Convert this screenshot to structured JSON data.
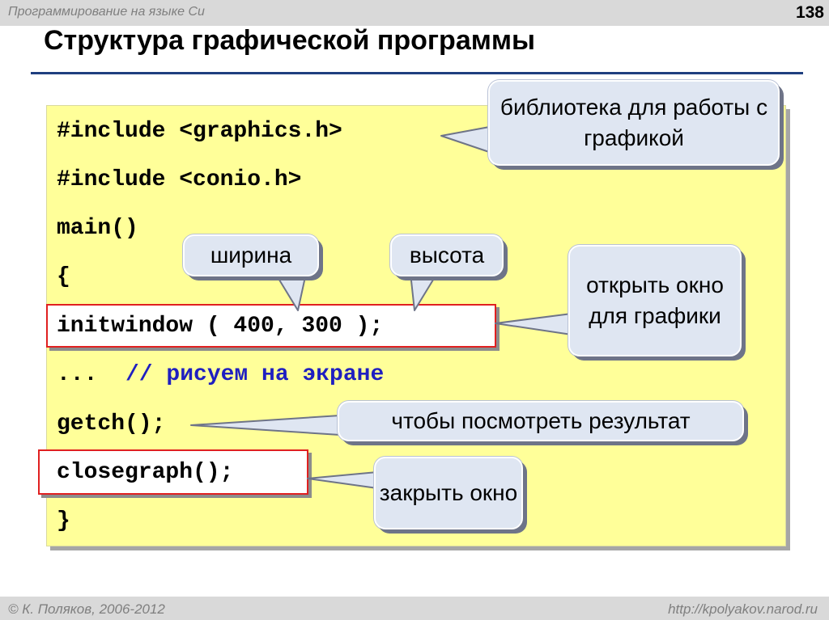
{
  "header": {
    "course": "Программирование на языке Си",
    "page_number": "138"
  },
  "slide": {
    "title": "Структура графической программы"
  },
  "code": {
    "lines": [
      "#include <graphics.h>",
      "#include <conio.h>",
      "main()",
      "{",
      "initwindow ( 400, 300 );",
      "... ",
      "// рисуем на экране",
      "getch();",
      "closegraph();",
      "}"
    ]
  },
  "callouts": {
    "library": "библиотека для работы с графикой",
    "width": "ширина",
    "height": "высота",
    "open_window": "открыть окно для графики",
    "see_result": "чтобы посмотреть результат",
    "close_window": "закрыть окно"
  },
  "footer": {
    "author": "© К. Поляков, 2006-2012",
    "url": "http://kpolyakov.narod.ru"
  },
  "colors": {
    "code_background": "#ffff99",
    "comment": "#1f1fc0",
    "highlight_border": "#e02020",
    "bubble": "#dfe6f2",
    "title_rule": "#1f3f7f"
  }
}
